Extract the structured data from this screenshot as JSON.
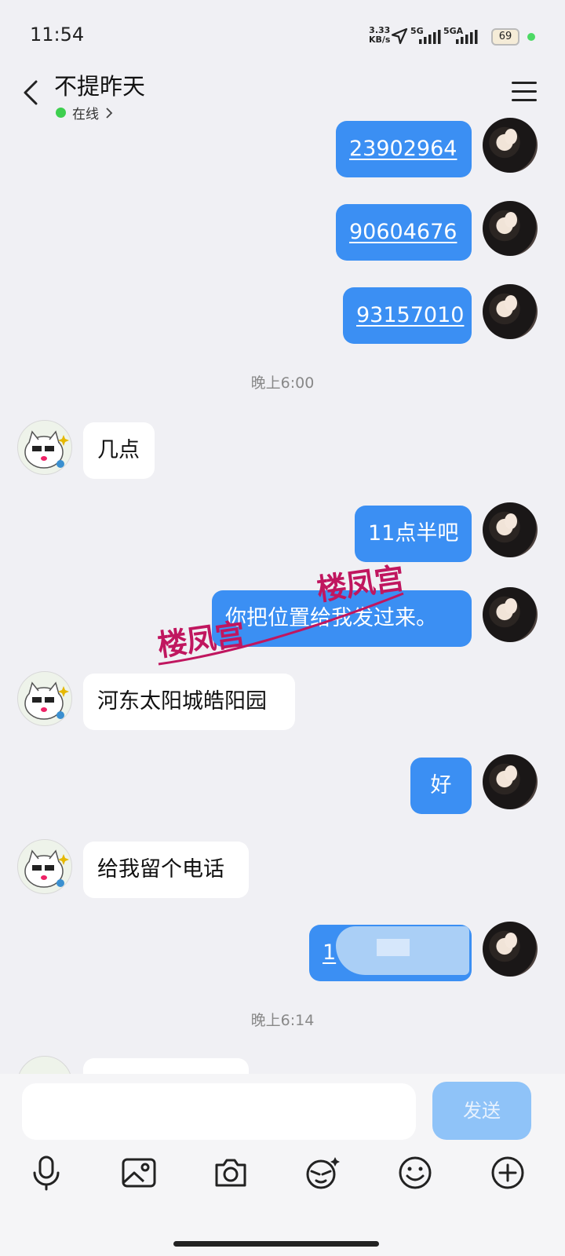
{
  "status_bar": {
    "time": "11:54",
    "net_speed_value": "3.33",
    "net_speed_unit": "KB/s",
    "sim1": "5G",
    "sim2": "5GA",
    "battery": "69"
  },
  "header": {
    "contact_name": "不提昨天",
    "status": "在线"
  },
  "messages": {
    "m1": "23902964",
    "m2": "90604676",
    "m3": "93157010",
    "time1": "晚上6:00",
    "m4": "几点",
    "m5": "11点半吧",
    "m6": "你把位置给我发过来。",
    "m7": "河东太阳城皓阳园",
    "m8": "好",
    "m9": "给我留个电话",
    "m10": "1",
    "time2": "晚上6:14"
  },
  "watermark": {
    "text": "楼凤宫"
  },
  "input": {
    "placeholder": "",
    "send_label": "发送"
  },
  "colors": {
    "outgoing_bubble": "#3b8ff3",
    "incoming_bubble": "#ffffff",
    "background": "#f0f0f4",
    "send_button": "#8fc3f8",
    "online_dot": "#3ecf4f"
  }
}
